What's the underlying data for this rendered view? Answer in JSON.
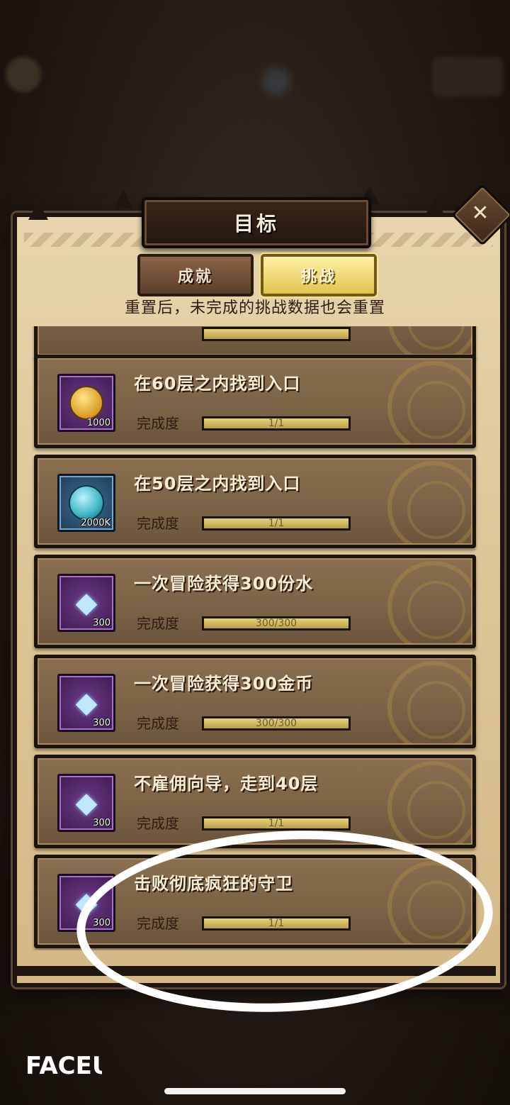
{
  "panel": {
    "title": "目标",
    "tabs": [
      {
        "label": "成就",
        "active": false
      },
      {
        "label": "挑战",
        "active": true
      }
    ],
    "notice": "重置后，未完成的挑战数据也会重置"
  },
  "progress_label": "完成度",
  "tasks": [
    {
      "title": "在60层之内找到入口",
      "reward_icon": "gold-coin-icon",
      "reward_count": "1000",
      "progress_text": "1/1",
      "progress": 1.0,
      "frame": "purple"
    },
    {
      "title": "在50层之内找到入口",
      "reward_icon": "crystal-orb-icon",
      "reward_count": "2000K",
      "progress_text": "1/1",
      "progress": 1.0,
      "frame": "blue"
    },
    {
      "title": "一次冒险获得300份水",
      "reward_icon": "diamond-icon",
      "reward_count": "300",
      "progress_text": "300/300",
      "progress": 1.0,
      "frame": "purple"
    },
    {
      "title": "一次冒险获得300金币",
      "reward_icon": "diamond-icon",
      "reward_count": "300",
      "progress_text": "300/300",
      "progress": 1.0,
      "frame": "purple"
    },
    {
      "title": "不雇佣向导，走到40层",
      "reward_icon": "diamond-icon",
      "reward_count": "300",
      "progress_text": "1/1",
      "progress": 1.0,
      "frame": "purple"
    },
    {
      "title": "击败彻底疯狂的守卫",
      "reward_icon": "diamond-icon",
      "reward_count": "300",
      "progress_text": "1/1",
      "progress": 1.0,
      "frame": "purple"
    }
  ],
  "watermark": "FACEU",
  "colors": {
    "panel": "#dcc495",
    "card": "#7a6246",
    "progress_fill": "#d4c06a",
    "annotation": "#ffffff"
  }
}
